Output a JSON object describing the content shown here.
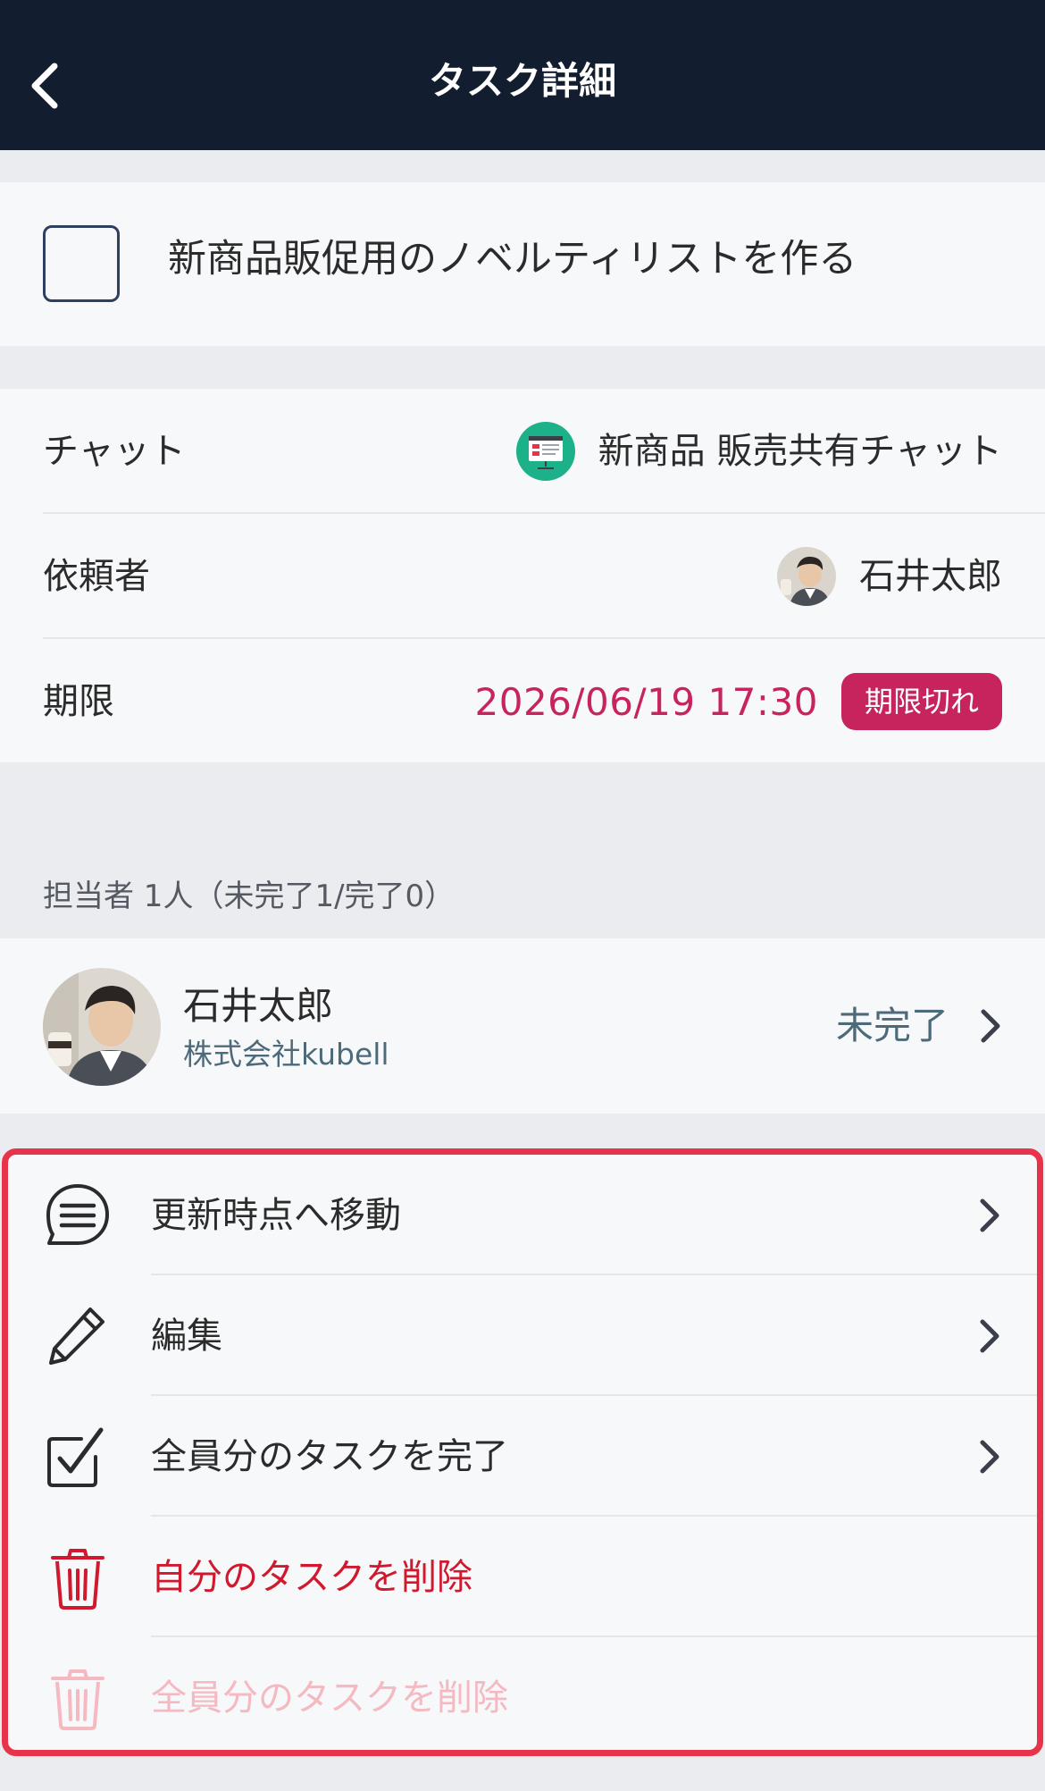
{
  "header": {
    "title": "タスク詳細"
  },
  "task": {
    "title": "新商品販促用のノベルティリストを作る",
    "completed": false
  },
  "info": {
    "chat_label": "チャット",
    "chat_value": "新商品 販売共有チャット",
    "requester_label": "依頼者",
    "requester_value": "石井太郎",
    "deadline_label": "期限",
    "deadline_value": "2026/06/19 17:30",
    "overdue_badge": "期限切れ"
  },
  "assignees": {
    "section_label": "担当者 1人（未完了1/完了0）",
    "items": [
      {
        "name": "石井太郎",
        "company": "株式会社kubell",
        "status": "未完了"
      }
    ]
  },
  "actions": [
    {
      "label": "更新時点へ移動",
      "icon": "chat-bubble-icon",
      "style": "normal"
    },
    {
      "label": "編集",
      "icon": "pencil-icon",
      "style": "normal"
    },
    {
      "label": "全員分のタスクを完了",
      "icon": "checkbox-check-icon",
      "style": "normal"
    },
    {
      "label": "自分のタスクを削除",
      "icon": "trash-icon",
      "style": "danger"
    },
    {
      "label": "全員分のタスクを削除",
      "icon": "trash-icon",
      "style": "disabled"
    }
  ],
  "colors": {
    "header_bg": "#121e30",
    "accent_red": "#c7245e",
    "danger_red": "#d0182e",
    "highlight_border": "#e8344a",
    "status_teal": "#4d6a7a"
  }
}
